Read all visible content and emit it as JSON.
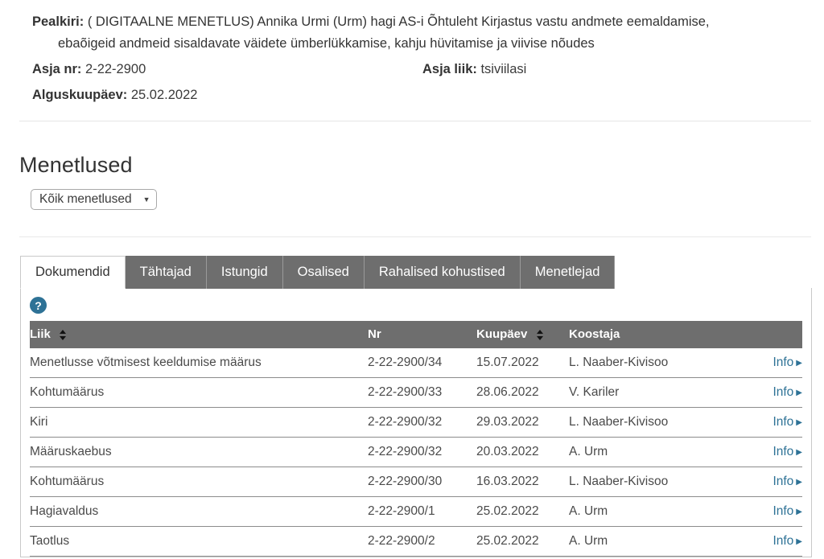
{
  "case_header": {
    "title_label": "Pealkiri:",
    "title_line1": "( DIGITAALNE MENETLUS) Annika Urmi (Urm) hagi AS-i Õhtuleht Kirjastus vastu andmete eemaldamise,",
    "title_line2": "ebaõigeid andmeid sisaldavate väidete ümberlükkamise, kahju hüvitamise ja viivise nõudes",
    "case_nr_label": "Asja nr:",
    "case_nr_value": "2-22-2900",
    "case_type_label": "Asja liik:",
    "case_type_value": "tsiviilasi",
    "start_date_label": "Alguskuupäev:",
    "start_date_value": "25.02.2022"
  },
  "section": {
    "heading": "Menetlused",
    "filter_select": {
      "selected": "Kõik menetlused",
      "caret": "▼"
    }
  },
  "tabs": [
    {
      "label": "Dokumendid",
      "active": true
    },
    {
      "label": "Tähtajad",
      "active": false
    },
    {
      "label": "Istungid",
      "active": false
    },
    {
      "label": "Osalised",
      "active": false
    },
    {
      "label": "Rahalised kohustised",
      "active": false
    },
    {
      "label": "Menetlejad",
      "active": false
    }
  ],
  "help": {
    "glyph": "?"
  },
  "table": {
    "columns": [
      {
        "label": "Liik",
        "sortable": true
      },
      {
        "label": "Nr",
        "sortable": false
      },
      {
        "label": "Kuupäev",
        "sortable": true
      },
      {
        "label": "Koostaja",
        "sortable": false
      },
      {
        "label": "",
        "sortable": false
      }
    ],
    "rows": [
      {
        "liik": "Menetlusse võtmisest keeldumise määrus",
        "nr": "2-22-2900/34",
        "kuupaev": "15.07.2022",
        "koostaja": "L. Naaber-Kivisoo",
        "info": "Info",
        "info_arrow": "▶"
      },
      {
        "liik": "Kohtumäärus",
        "nr": "2-22-2900/33",
        "kuupaev": "28.06.2022",
        "koostaja": "V. Kariler",
        "info": "Info",
        "info_arrow": "▶"
      },
      {
        "liik": "Kiri",
        "nr": "2-22-2900/32",
        "kuupaev": "29.03.2022",
        "koostaja": "L. Naaber-Kivisoo",
        "info": "Info",
        "info_arrow": "▶"
      },
      {
        "liik": "Määruskaebus",
        "nr": "2-22-2900/32",
        "kuupaev": "20.03.2022",
        "koostaja": "A. Urm",
        "info": "Info",
        "info_arrow": "▶"
      },
      {
        "liik": "Kohtumäärus",
        "nr": "2-22-2900/30",
        "kuupaev": "16.03.2022",
        "koostaja": "L. Naaber-Kivisoo",
        "info": "Info",
        "info_arrow": "▶"
      },
      {
        "liik": "Hagiavaldus",
        "nr": "2-22-2900/1",
        "kuupaev": "25.02.2022",
        "koostaja": "A. Urm",
        "info": "Info",
        "info_arrow": "▶"
      },
      {
        "liik": "Taotlus",
        "nr": "2-22-2900/2",
        "kuupaev": "25.02.2022",
        "koostaja": "A. Urm",
        "info": "Info",
        "info_arrow": "▶"
      }
    ]
  },
  "colors": {
    "tab_inactive_bg": "#6e6e6e",
    "table_header_bg": "#6e6e6e",
    "link": "#2e7296",
    "help_icon_bg": "#2e7296"
  }
}
